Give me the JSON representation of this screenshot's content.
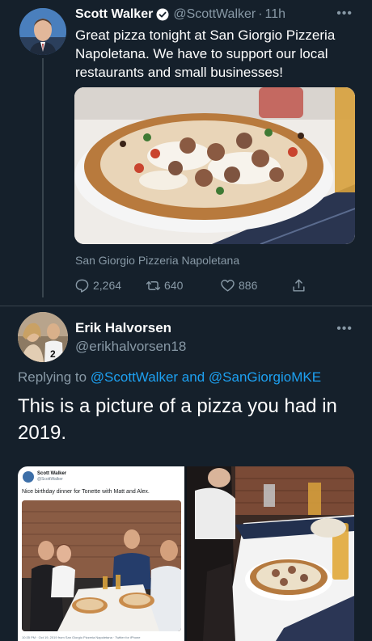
{
  "tweet": {
    "author_name": "Scott Walker",
    "handle": "@ScottWalker",
    "separator": "·",
    "time": "11h",
    "text": "Great pizza tonight at San Giorgio Pizzeria Napoletana. We have to support our local restaurants and small businesses!",
    "link_caption": "San Giorgio Pizzeria Napoletana",
    "replies": "2,264",
    "retweets": "640",
    "likes": "886",
    "more_icon": "more-horizontal-icon",
    "verified_color": "#1da1f2"
  },
  "reply": {
    "author_name": "Erik Halvorsen",
    "handle": "@erikhalvorsen18",
    "replying_prefix": "Replying to",
    "mention1": "@ScottWalker",
    "and": "and",
    "mention2": "@SanGiorgioMKE",
    "text": "This is a picture of a pizza you had in 2019.",
    "embedded_tweet": {
      "author_name": "Scott Walker",
      "handle": "@ScottWalker",
      "text": "Nice birthday dinner for Tonette with Matt and Alex.",
      "footer": "10:35 PM · Oct 19, 2019 from San Giorgio Pizzeria Napoletana · Twitter for iPhone"
    }
  },
  "theme": {
    "background": "#15202b",
    "secondary_text": "#8899a6",
    "accent": "#1da1f2",
    "divider": "#38444d"
  }
}
